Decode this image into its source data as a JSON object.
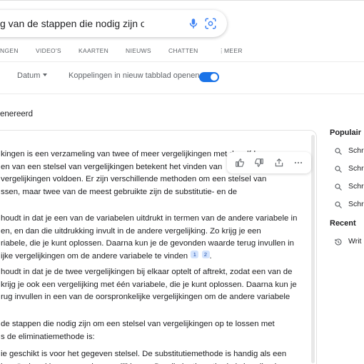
{
  "search": {
    "query": "g van de stappen die nodig zijn om een stel"
  },
  "nav": {
    "tabs": [
      "NGEN",
      "VIDEO'S",
      "KAARTEN",
      "NIEUWS",
      "CHATTEN",
      "MEER"
    ]
  },
  "tools": {
    "date_label": "Datum",
    "new_tab_label": "Koppelingen in nieuw tabblad openen"
  },
  "ai": {
    "heading": "enereerd",
    "p1": "kingen is een verzameling van twee of meer vergelijkingen met dezelfde\nen van een stelsel van vergelijkingen betekent het vinden van\nvergelijkingen voldoen. Er zijn verschillende methoden om een stelsel van\nssen, maar twee van de meest gebruikte zijn de substitutie- en de",
    "p2": "houdt in dat je een van de variabelen uitdrukt in termen van de andere variabele in\nen, en dan die uitdrukking invult in de andere vergelijking. Zo krijg je een\nriabele, die je kunt oplossen. Daarna kun je de gevonden waarde terug invullen in\nijke vergelijkingen om de andere variabele te vinden",
    "p3": "houdt in dat je de twee vergelijkingen bij elkaar optelt of aftrekt, zodat een van de\nkrijg je ook een vergelijking met één variabele, die je kunt oplossen. Daarna kun je\nrug invullen in een van de oorspronkelijke vergelijkingen om de andere variabele",
    "p4": "de stappen die nodig zijn om een stelsel van vergelijkingen op te lossen met\ns de eliminatiemethode is:",
    "p5": "ie geschikt is voor het gegeven stelsel. De substitutiemethode is handig als een\nis geïsoleerd in een van de vergelijkingen. De eliminatiemethode is handig als",
    "cite1": "1",
    "cite2": "2",
    "cite_tail": "."
  },
  "sidebar": {
    "popular_heading": "Populair",
    "popular_items": [
      "Schr",
      "Schr",
      "Schr",
      "Schr"
    ],
    "recent_heading": "Recent",
    "recent_items": [
      "Writ"
    ]
  },
  "colors": {
    "accent": "#1a73e8",
    "cite_bg": "#d3e3fd"
  }
}
